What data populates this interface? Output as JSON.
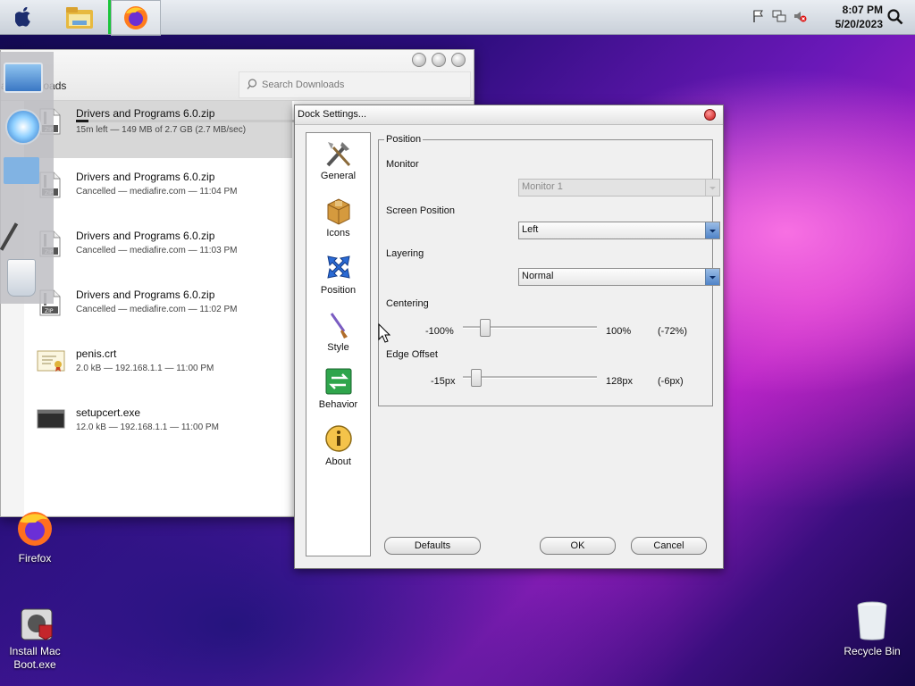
{
  "menubar": {
    "time": "8:07 PM",
    "date": "5/20/2023"
  },
  "downloads": {
    "title_partial": "ar Downloads",
    "search_placeholder": "Search Downloads",
    "items": [
      {
        "name": "Drivers and Programs 6.0.zip",
        "status": "15m left — 149 MB of 2.7 GB (2.7 MB/sec)",
        "progress": 0.055,
        "icon": "zip-file-icon"
      },
      {
        "name": "Drivers and Programs 6.0.zip",
        "status": "Cancelled — mediafire.com — 11:04 PM",
        "icon": "zip-file-icon"
      },
      {
        "name": "Drivers and Programs 6.0.zip",
        "status": "Cancelled — mediafire.com — 11:03 PM",
        "icon": "zip-file-icon"
      },
      {
        "name": "Drivers and Programs 6.0.zip",
        "status": "Cancelled — mediafire.com — 11:02 PM",
        "icon": "zip-file-icon"
      },
      {
        "name": "penis.crt",
        "status": "2.0 kB — 192.168.1.1 — 11:00 PM",
        "icon": "certificate-icon"
      },
      {
        "name": "setupcert.exe",
        "status": "12.0 kB — 192.168.1.1 — 11:00 PM",
        "icon": "exe-file-icon"
      }
    ]
  },
  "dialog": {
    "title": "Dock Settings...",
    "tabs": [
      {
        "label": "General",
        "icon": "tools-icon"
      },
      {
        "label": "Icons",
        "icon": "box-icon"
      },
      {
        "label": "Position",
        "icon": "arrows-icon"
      },
      {
        "label": "Style",
        "icon": "brush-icon"
      },
      {
        "label": "Behavior",
        "icon": "switch-arrows-icon"
      },
      {
        "label": "About",
        "icon": "info-icon"
      }
    ],
    "group_title": "Position",
    "monitor_label": "Monitor",
    "monitor_value": "Monitor 1",
    "screen_position_label": "Screen Position",
    "screen_position_value": "Left",
    "layering_label": "Layering",
    "layering_value": "Normal",
    "centering_label": "Centering",
    "centering_min": "-100%",
    "centering_max": "100%",
    "centering_value": "(-72%)",
    "centering_fraction": 0.14,
    "edge_offset_label": "Edge Offset",
    "edge_offset_min": "-15px",
    "edge_offset_max": "128px",
    "edge_offset_value": "(-6px)",
    "edge_offset_fraction": 0.063,
    "defaults_button": "Defaults",
    "ok_button": "OK",
    "cancel_button": "Cancel"
  },
  "desktop": {
    "firefox_label": "Firefox",
    "installer_label_line1": "Install Mac",
    "installer_label_line2": "Boot.exe",
    "recycle_label": "Recycle Bin"
  },
  "colors": {
    "progress": "#1a1a1a",
    "selected_row": "#d7d7d7",
    "combo_arrow": "#4f83c8"
  }
}
